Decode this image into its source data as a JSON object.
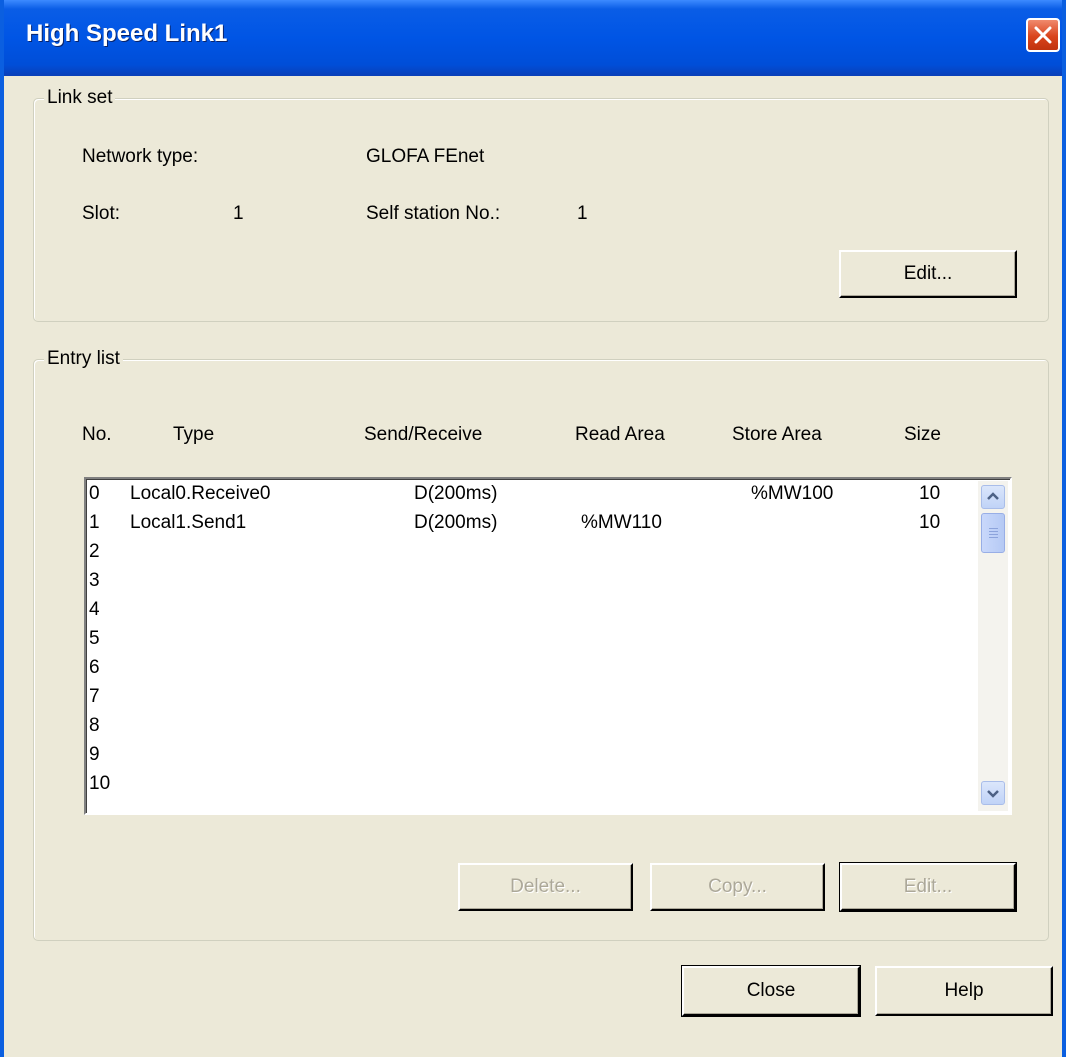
{
  "window": {
    "title": "High Speed Link1",
    "close_icon": "close-icon"
  },
  "link_set": {
    "legend": "Link set",
    "network_type_label": "Network type:",
    "network_type_value": "GLOFA FEnet",
    "slot_label": "Slot:",
    "slot_value": "1",
    "self_station_label": "Self station No.:",
    "self_station_value": "1",
    "edit_label": "Edit..."
  },
  "entry_list": {
    "legend": "Entry list",
    "columns": [
      "No.",
      "Type",
      "Send/Receive",
      "Read Area",
      "Store Area",
      "Size"
    ],
    "rows": [
      {
        "no": "0",
        "type": "Local0.Receive0",
        "send_receive": "D(200ms)",
        "read_area": "",
        "store_area": "%MW100",
        "size": "10"
      },
      {
        "no": "1",
        "type": "Local1.Send1",
        "send_receive": "D(200ms)",
        "read_area": "%MW110",
        "store_area": "",
        "size": "10"
      },
      {
        "no": "2",
        "type": "",
        "send_receive": "",
        "read_area": "",
        "store_area": "",
        "size": ""
      },
      {
        "no": "3",
        "type": "",
        "send_receive": "",
        "read_area": "",
        "store_area": "",
        "size": ""
      },
      {
        "no": "4",
        "type": "",
        "send_receive": "",
        "read_area": "",
        "store_area": "",
        "size": ""
      },
      {
        "no": "5",
        "type": "",
        "send_receive": "",
        "read_area": "",
        "store_area": "",
        "size": ""
      },
      {
        "no": "6",
        "type": "",
        "send_receive": "",
        "read_area": "",
        "store_area": "",
        "size": ""
      },
      {
        "no": "7",
        "type": "",
        "send_receive": "",
        "read_area": "",
        "store_area": "",
        "size": ""
      },
      {
        "no": "8",
        "type": "",
        "send_receive": "",
        "read_area": "",
        "store_area": "",
        "size": ""
      },
      {
        "no": "9",
        "type": "",
        "send_receive": "",
        "read_area": "",
        "store_area": "",
        "size": ""
      },
      {
        "no": "10",
        "type": "",
        "send_receive": "",
        "read_area": "",
        "store_area": "",
        "size": ""
      }
    ],
    "delete_label": "Delete...",
    "copy_label": "Copy...",
    "edit_label": "Edit..."
  },
  "footer": {
    "close_label": "Close",
    "help_label": "Help"
  },
  "colors": {
    "title_bar": "#0055e5",
    "dialog_bg": "#ece9d8",
    "close_button": "#d9441c",
    "disabled_text": "#aca899"
  }
}
